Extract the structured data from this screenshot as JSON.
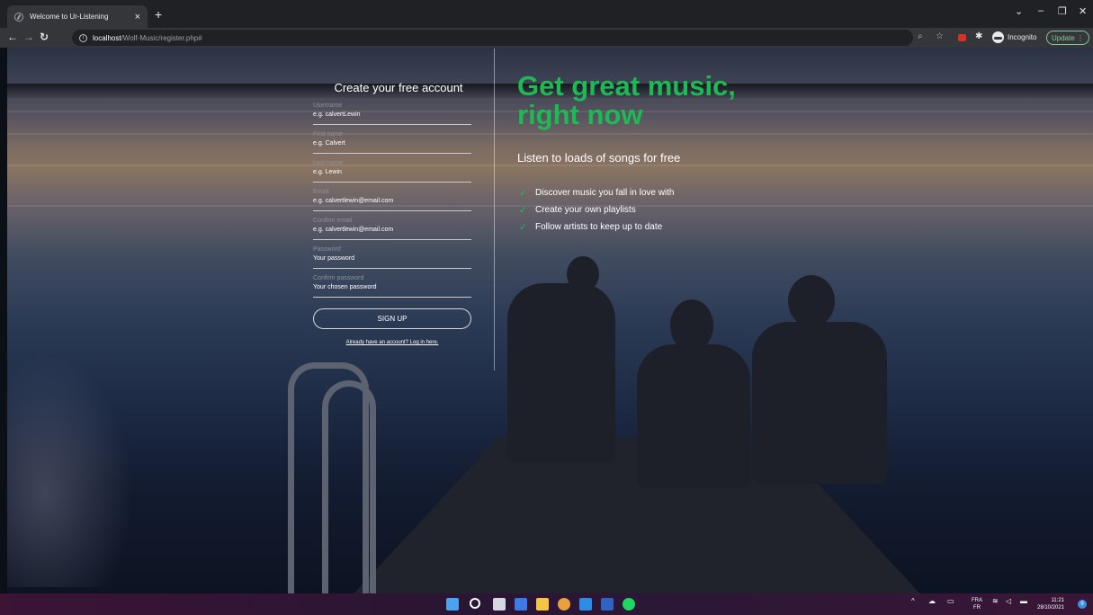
{
  "browser": {
    "tab_title": "Welcome to Ur-Listening",
    "tab_close": "×",
    "new_tab": "+",
    "url_host": "localhost",
    "url_path": "/Wolf-Music/register.php#",
    "incognito_label": "Incognito",
    "update_label": "Update"
  },
  "form": {
    "title": "Create your free account",
    "fields": [
      {
        "label": "Username",
        "placeholder": "e.g. calvertLewin"
      },
      {
        "label": "First name",
        "placeholder": "e.g. Calvert"
      },
      {
        "label": "Last name",
        "placeholder": "e.g. Lewin"
      },
      {
        "label": "Email",
        "placeholder": "e.g. calvertlewin@email.com"
      },
      {
        "label": "Confirm email",
        "placeholder": "e.g. calvertlewin@email.com"
      },
      {
        "label": "Password",
        "placeholder": "Your password"
      },
      {
        "label": "Confirm password",
        "placeholder": "Your chosen password"
      }
    ],
    "signup_label": "SIGN UP",
    "login_link": "Already have an account? Log in here."
  },
  "hero": {
    "headline_line1": "Get great music,",
    "headline_line2": "right now",
    "subheading": "Listen to loads of songs for free",
    "features": [
      "Discover music you fall in love with",
      "Create your own playlists",
      "Follow artists to keep up to date"
    ]
  },
  "taskbar": {
    "lang_top": "FRA",
    "lang_bottom": "FR",
    "time": "11:21",
    "date": "28/10/2021",
    "notifications": "9"
  },
  "colors": {
    "accent_green": "#1db954",
    "chrome_dark": "#202124",
    "chrome_toolbar": "#35363a"
  }
}
